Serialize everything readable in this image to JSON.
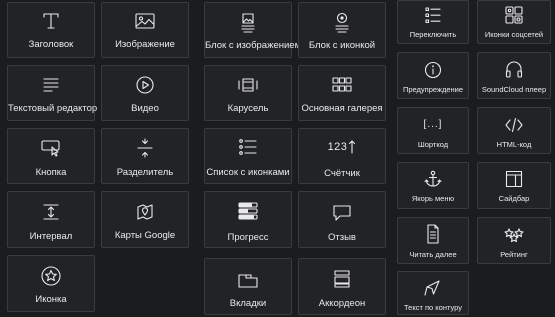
{
  "widgets": {
    "col1": [
      {
        "label": "Заголовок",
        "icon": "heading-icon"
      },
      {
        "label": "Текстовый редактор",
        "icon": "text-editor-icon"
      },
      {
        "label": "Кнопка",
        "icon": "button-icon"
      },
      {
        "label": "Интервал",
        "icon": "spacer-icon"
      },
      {
        "label": "Иконка",
        "icon": "icon-star-icon"
      }
    ],
    "col2": [
      {
        "label": "Изображение",
        "icon": "image-icon"
      },
      {
        "label": "Видео",
        "icon": "video-icon"
      },
      {
        "label": "Разделитель",
        "icon": "divider-icon"
      },
      {
        "label": "Карты Google",
        "icon": "map-icon"
      }
    ],
    "col3": [
      {
        "label": "Блок с изображением",
        "icon": "image-box-icon"
      },
      {
        "label": "Карусель",
        "icon": "carousel-icon"
      },
      {
        "label": "Список с иконками",
        "icon": "icon-list-icon"
      },
      {
        "label": "Прогресс",
        "icon": "progress-icon"
      },
      {
        "label": "Вкладки",
        "icon": "tabs-icon"
      }
    ],
    "col4": [
      {
        "label": "Блок с иконкой",
        "icon": "icon-box-icon"
      },
      {
        "label": "Основная галерея",
        "icon": "gallery-icon"
      },
      {
        "label": "Счётчик",
        "icon": "counter-icon",
        "icon_text": "123"
      },
      {
        "label": "Отзыв",
        "icon": "testimonial-icon"
      },
      {
        "label": "Аккордеон",
        "icon": "accordion-icon"
      }
    ],
    "col5": [
      {
        "label": "Переключить",
        "icon": "toggle-icon"
      },
      {
        "label": "Предупреждение",
        "icon": "alert-icon"
      },
      {
        "label": "Шорткод",
        "icon": "shortcode-icon",
        "icon_text": "[...]"
      },
      {
        "label": "Якорь меню",
        "icon": "anchor-icon"
      },
      {
        "label": "Читать далее",
        "icon": "read-more-icon"
      },
      {
        "label": "Текст по контуру",
        "icon": "text-path-icon"
      }
    ],
    "col6": [
      {
        "label": "Иконки соцсетей",
        "icon": "social-icons-icon"
      },
      {
        "label": "SoundCloud плеер",
        "icon": "soundcloud-icon"
      },
      {
        "label": "HTML-код",
        "icon": "html-code-icon"
      },
      {
        "label": "Сайдбар",
        "icon": "sidebar-icon"
      },
      {
        "label": "Рейтинг",
        "icon": "rating-icon"
      }
    ]
  }
}
